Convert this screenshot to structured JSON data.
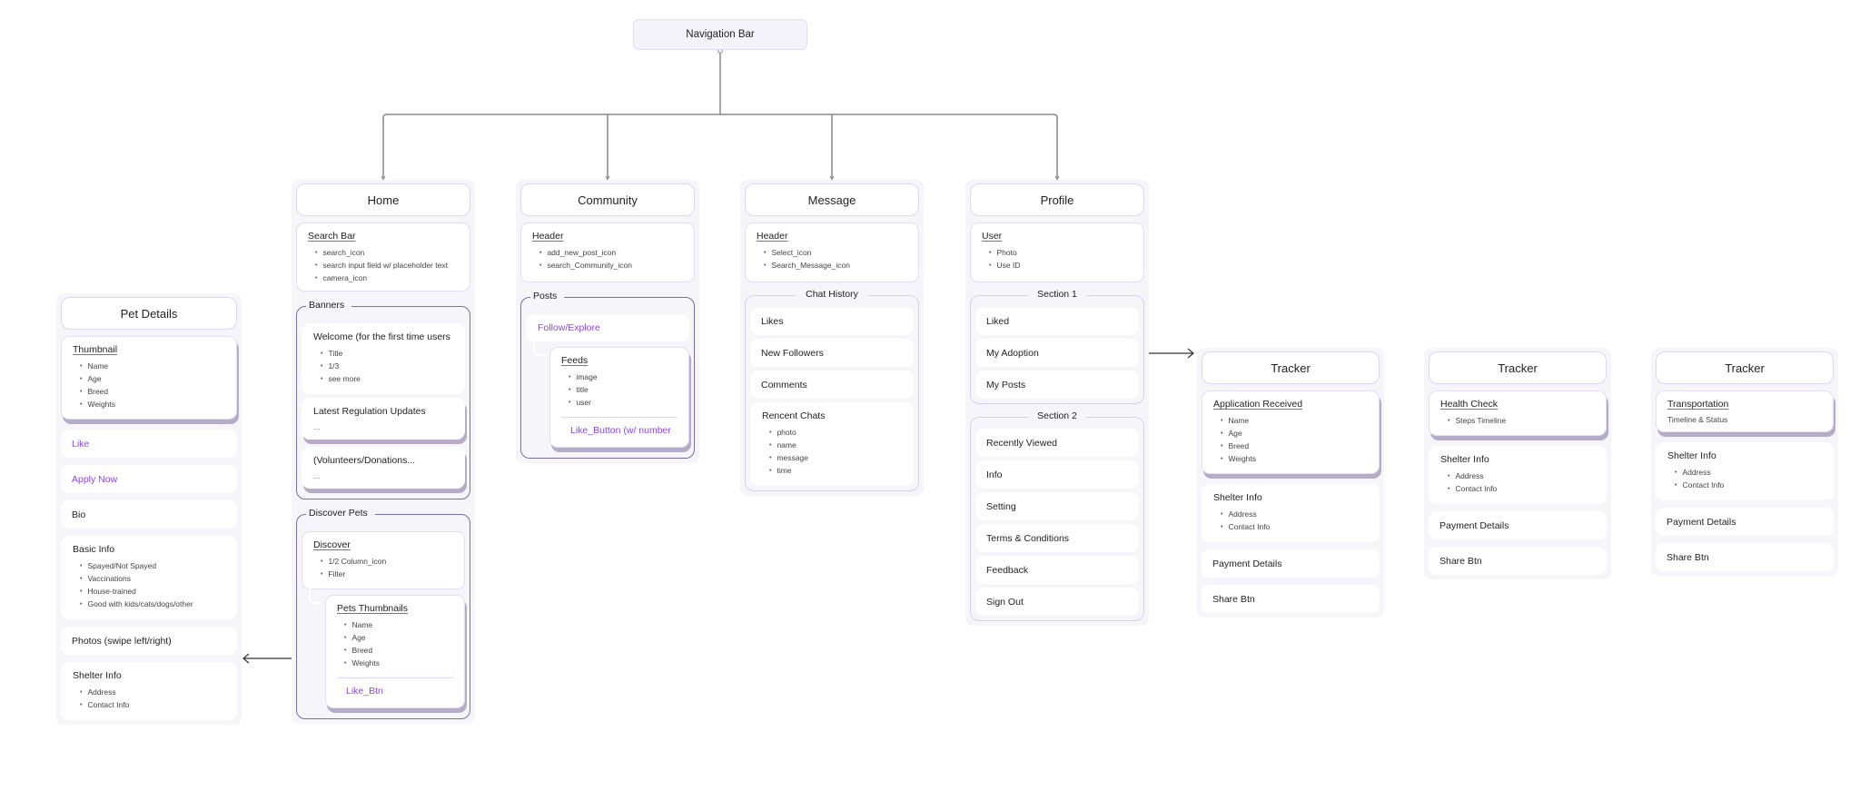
{
  "nav_bar": {
    "label": "Navigation Bar"
  },
  "home": {
    "title": "Home",
    "search_bar": {
      "heading": "Search Bar",
      "items": [
        "search_icon",
        "search input field w/ placeholder text",
        "camera_icon"
      ]
    },
    "banners": {
      "label": "Banners",
      "welcome": {
        "heading": "Welcome (for the first time users",
        "items": [
          "Title",
          "1/3",
          "see more"
        ]
      },
      "regulation": {
        "heading": "Latest Regulation Updates",
        "text": "..."
      },
      "volunteers": {
        "heading": "(Volunteers/Donations...",
        "text": "..."
      }
    },
    "discover_pets": {
      "label": "Discover Pets",
      "discover": {
        "heading": "Discover",
        "items": [
          "1/2 Column_icon",
          "Filter"
        ]
      },
      "thumbnails": {
        "heading": "Pets Thumbnails",
        "items": [
          "Name",
          "Age",
          "Breed",
          "Weights"
        ],
        "action": "Like_Btn"
      }
    }
  },
  "community": {
    "title": "Community",
    "header": {
      "heading": "Header",
      "items": [
        "add_new_post_icon",
        "search_Community_icon"
      ]
    },
    "posts": {
      "label": "Posts",
      "follow": "Follow/Explore",
      "feeds": {
        "heading": "Feeds",
        "items": [
          "image",
          "title",
          "user"
        ],
        "action": "Like_Button (w/ number"
      }
    }
  },
  "message": {
    "title": "Message",
    "header": {
      "heading": "Header",
      "items": [
        "Select_icon",
        "Search_Message_icon"
      ]
    },
    "chat_history": {
      "label": "Chat History",
      "rows": [
        "Likes",
        "New Followers",
        "Comments"
      ],
      "recent": {
        "heading": "Rencent Chats",
        "items": [
          "photo",
          "name",
          "message",
          "time"
        ]
      }
    }
  },
  "profile": {
    "title": "Profile",
    "user": {
      "heading": "User",
      "items": [
        "Photo",
        "Use ID"
      ]
    },
    "section1": {
      "label": "Section 1",
      "rows": [
        "Liked",
        "My Adoption",
        "My Posts"
      ]
    },
    "section2": {
      "label": "Section 2",
      "rows": [
        "Recently Viewed",
        "Info",
        "Setting",
        "Terms & Conditions",
        "Feedback",
        "Sign Out"
      ]
    }
  },
  "pet_details": {
    "title": "Pet Details",
    "thumbnail": {
      "heading": "Thumbnail",
      "items": [
        "Name",
        "Age",
        "Breed",
        "Weights"
      ]
    },
    "like": "Like",
    "apply": "Apply Now",
    "bio": "Bio",
    "basic_info": {
      "heading": "Basic Info",
      "items": [
        "Spayed/Not Spayed",
        "Vaccinations",
        "House-trained",
        "Good with kids/cats/dogs/other"
      ]
    },
    "photos": "Photos (swipe left/right)",
    "shelter": {
      "heading": "Shelter Info",
      "items": [
        "Address",
        "Contact Info"
      ]
    }
  },
  "trackers": [
    {
      "title": "Tracker",
      "top": {
        "heading": "Application Received",
        "items": [
          "Name",
          "Age",
          "Breed",
          "Weights"
        ]
      },
      "shelter": {
        "heading": "Shelter Info",
        "items": [
          "Address",
          "Contact Info"
        ]
      },
      "payment": "Payment Details",
      "share": "Share Btn"
    },
    {
      "title": "Tracker",
      "top": {
        "heading": "Health Check",
        "items": [
          "Steps Timeline"
        ]
      },
      "shelter": {
        "heading": "Shelter Info",
        "items": [
          "Address",
          "Contact Info"
        ]
      },
      "payment": "Payment Details",
      "share": "Share Btn"
    },
    {
      "title": "Tracker",
      "top": {
        "heading": "Transportation",
        "text": "Timeline & Status"
      },
      "shelter": {
        "heading": "Shelter Info",
        "items": [
          "Address",
          "Contact Info"
        ]
      },
      "payment": "Payment Details",
      "share": "Share Btn"
    }
  ],
  "colors": {
    "accent_purple": "#8b45f2",
    "group_border": "#7d6ea6",
    "panel_bg": "#f6f5fa",
    "card_border": "#e3ddf7"
  }
}
